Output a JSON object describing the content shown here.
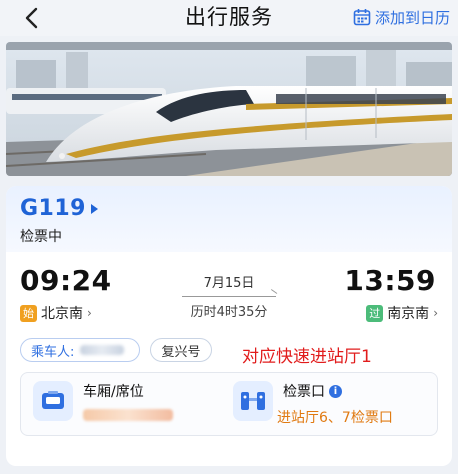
{
  "header": {
    "title": "出行服务",
    "add_calendar_label": "添加到日历"
  },
  "train": {
    "number": "G119",
    "status": "检票中"
  },
  "journey": {
    "departure_time": "09:24",
    "arrival_time": "13:59",
    "date": "7月15日",
    "duration": "历时4时35分",
    "departure_station": "北京南",
    "arrival_station": "南京南",
    "departure_badge": "始",
    "arrival_badge": "过"
  },
  "passenger": {
    "label": "乘车人:",
    "train_model": "复兴号"
  },
  "annotation": "对应快速进站厅1",
  "details": {
    "seat_title": "车厢/席位",
    "gate_title": "检票口",
    "gate_value": "进站厅6、7检票口"
  },
  "colors": {
    "accent": "#2f6fe0",
    "train_number": "#1f63d6",
    "annotation": "#e11c1c",
    "gate_value": "#e07a12",
    "start_badge": "#f0a020",
    "pass_badge": "#4cbc7a"
  },
  "icons": {
    "back": "chevron-left-icon",
    "calendar": "calendar-icon",
    "train_number_arrow": "triangle-right-icon",
    "seat": "seat-icon",
    "gate": "ticket-gate-icon",
    "info": "info-icon"
  }
}
